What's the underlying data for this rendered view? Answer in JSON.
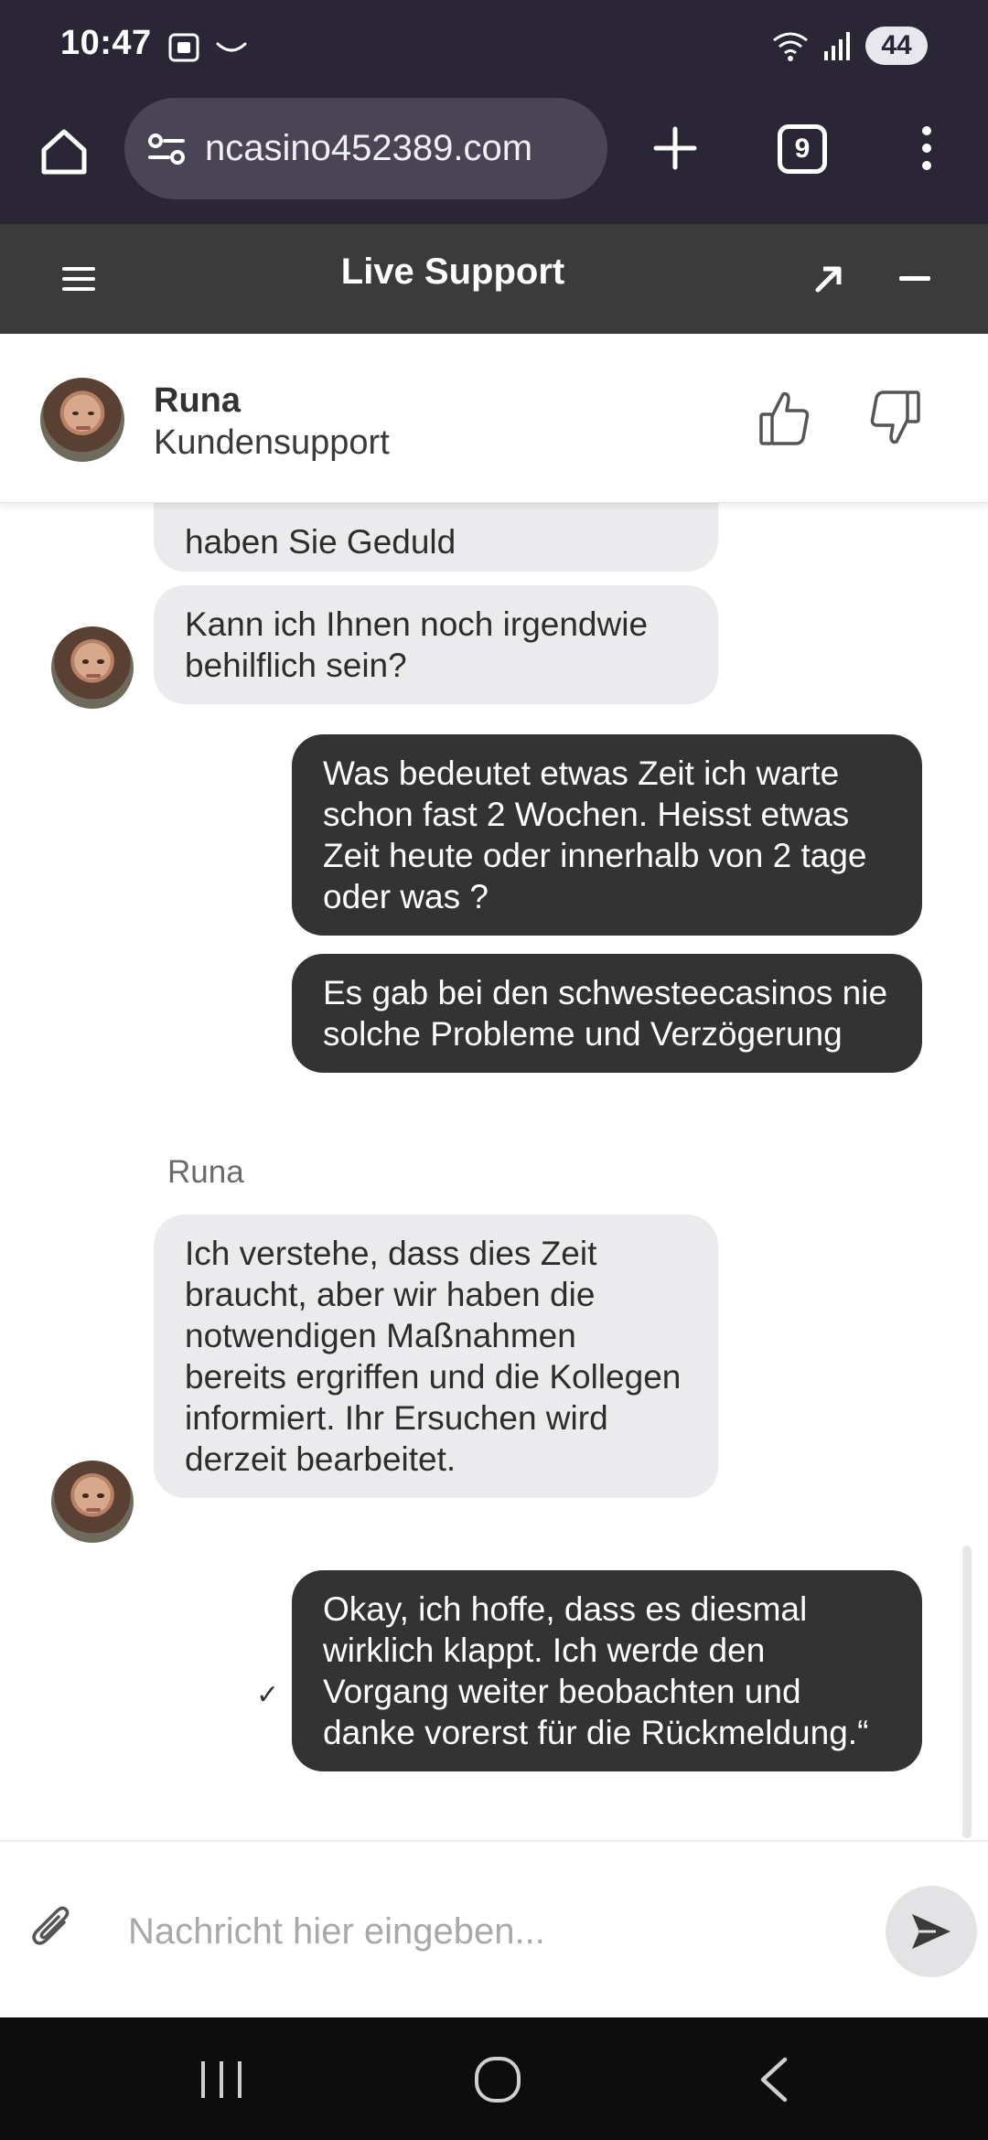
{
  "status_bar": {
    "time": "10:47",
    "battery": "44"
  },
  "browser": {
    "url": "ncasino452389.com",
    "tab_count": "9"
  },
  "chat_header": {
    "title": "Live Support"
  },
  "agent": {
    "name": "Runa",
    "role": "Kundensupport"
  },
  "messages": [
    {
      "direction": "in",
      "text": "haben Sie Geduld"
    },
    {
      "direction": "in",
      "text": "Kann ich Ihnen noch irgendwie behilflich sein?"
    },
    {
      "direction": "out",
      "text": "Was bedeutet etwas Zeit ich warte schon fast 2 Wochen.  Heisst etwas Zeit heute oder innerhalb von 2 tage oder was ?"
    },
    {
      "direction": "out",
      "text": "Es gab bei den schwesteecasinos nie solche Probleme und Verzögerung"
    },
    {
      "direction": "in",
      "text": "Ich verstehe, dass dies Zeit braucht, aber wir haben die notwendigen Maßnahmen bereits ergriffen und die Kollegen informiert. Ihr Ersuchen wird derzeit bearbeitet."
    },
    {
      "direction": "out",
      "text": "Okay, ich hoffe, dass es diesmal wirklich klappt. Ich werde den Vorgang weiter beobachten und danke vorerst für die Rückmeldung.“"
    }
  ],
  "sender_label": "Runa",
  "read_check": "✓",
  "composer": {
    "placeholder": "Nachricht hier eingeben..."
  },
  "colors": {
    "browser_bar": "#2b2636",
    "chat_header": "#3b3b3b",
    "incoming_bubble": "#ebebed",
    "outgoing_bubble": "#333333"
  }
}
